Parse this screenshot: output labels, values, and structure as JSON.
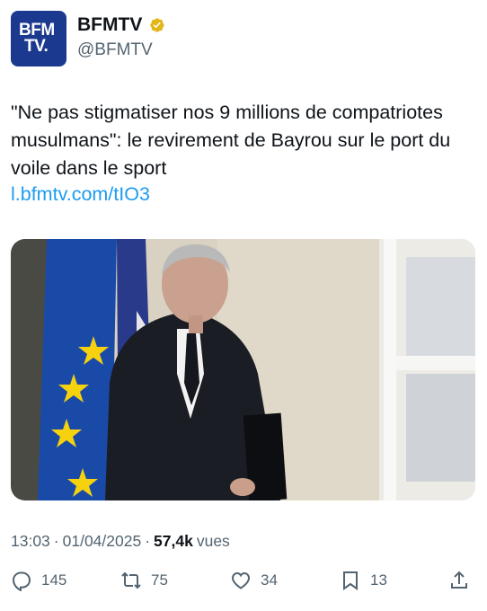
{
  "account": {
    "avatar_line1": "BFM",
    "avatar_line2": "TV.",
    "name": "BFMTV",
    "handle": "@BFMTV",
    "verified_color": "#e2b719"
  },
  "tweet": {
    "text": "\"Ne pas stigmatiser nos 9 millions de compatriotes musulmans\": le revirement de Bayrou sur le port du voile dans le sport",
    "link": "l.bfmtv.com/tIO3",
    "link_color": "#1d9bf0"
  },
  "meta": {
    "time": "13:03",
    "separator": "·",
    "date": "01/04/2025",
    "views_count": "57,4k",
    "views_label": "vues"
  },
  "actions": {
    "replies": "145",
    "reposts": "75",
    "likes": "34",
    "bookmarks": "13",
    "icons": [
      "reply-icon",
      "repost-icon",
      "like-icon",
      "bookmark-icon",
      "share-icon"
    ]
  }
}
